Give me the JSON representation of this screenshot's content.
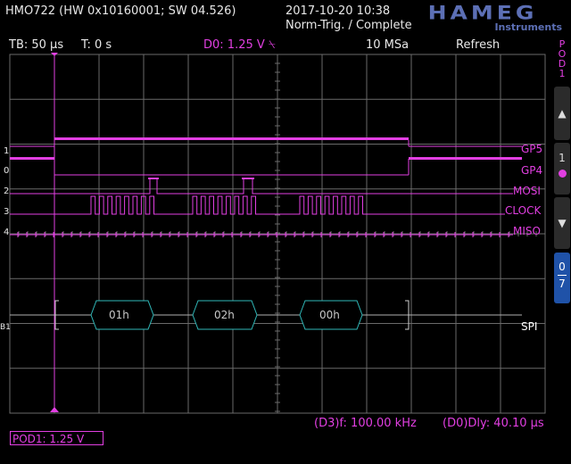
{
  "header": {
    "device": "HMO722 (HW 0x10160001; SW 04.526)",
    "datetime": "2017-10-20 10:38",
    "trigger_status": "Norm-Trig. / Complete",
    "logo": "HAMEG",
    "logo_sub": "Instruments"
  },
  "statusbar": {
    "timebase": "TB: 50 µs",
    "trigger_time": "T: 0 s",
    "trigger_level": "D0: 1.25 V ⍀",
    "sample_rate": "10 MSa",
    "mode": "Refresh"
  },
  "side": {
    "pod_label": "POD1",
    "up_icon": "▲",
    "channel_num": "1",
    "down_icon": "▼",
    "range_top": "0",
    "range_bottom": "7"
  },
  "channel_markers": [
    "1",
    "0",
    "2",
    "3",
    "4"
  ],
  "signal_names": [
    "GP5",
    "GP4",
    "MOSI",
    "CLOCK",
    "MISO"
  ],
  "bus": {
    "marker": "B1",
    "name": "SPI",
    "bytes": [
      "01h",
      "02h",
      "00h"
    ]
  },
  "footer": {
    "frequency": "(D3)f: 100.00 kHz",
    "delay": "(D0)Dly: 40.10 µs",
    "pod_threshold": "POD1: 1.25 V"
  },
  "colors": {
    "magenta": "#e23fe2",
    "bus_cyan": "#2fb8b8",
    "grid": "#6a6a6a",
    "logo_blue": "#5c6fb5",
    "active_button": "#1f52a8"
  }
}
